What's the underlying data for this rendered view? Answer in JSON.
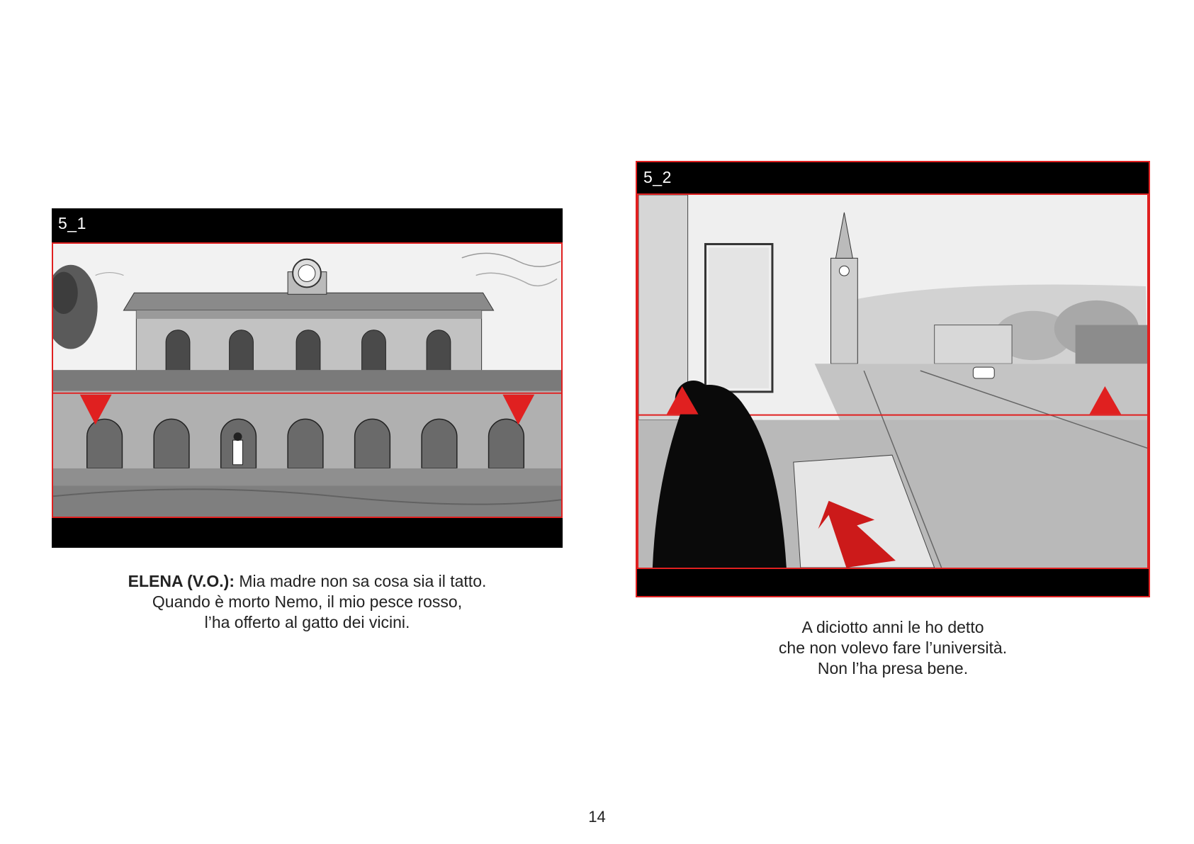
{
  "panels": [
    {
      "label": "5_1",
      "caption": {
        "speaker": "ELENA (V.O.):",
        "lines": [
          "Mia madre non sa cosa sia il tatto.",
          "Quando è morto Nemo, il mio pesce rosso,",
          "l’ha offerto al gatto dei vicini."
        ]
      }
    },
    {
      "label": "5_2",
      "caption": {
        "lines": [
          "A diciotto anni le ho detto",
          "che non volevo fare l’università.",
          "Non l’ha presa bene."
        ]
      }
    }
  ],
  "page_number": "14",
  "colors": {
    "accent": "#e02020",
    "frame_bg": "#000000"
  },
  "icons": [
    "down-triangle-marker-icon",
    "up-triangle-marker-icon",
    "camera-move-arrow-icon"
  ]
}
